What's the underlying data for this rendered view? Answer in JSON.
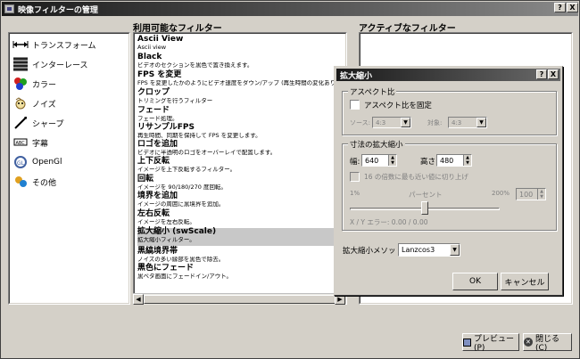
{
  "window": {
    "title": "映像フィルターの管理",
    "help_btn": "?",
    "close_btn": "X"
  },
  "headers": {
    "available": "利用可能なフィルター",
    "active": "アクティブなフィルター"
  },
  "categories": [
    {
      "label": "トランスフォーム",
      "icon": "transform-icon"
    },
    {
      "label": "インターレース",
      "icon": "interlace-icon"
    },
    {
      "label": "カラー",
      "icon": "color-icon"
    },
    {
      "label": "ノイズ",
      "icon": "noise-icon"
    },
    {
      "label": "シャープ",
      "icon": "sharpen-icon"
    },
    {
      "label": "字幕",
      "icon": "subtitle-icon"
    },
    {
      "label": "OpenGl",
      "icon": "opengl-icon"
    },
    {
      "label": "その他",
      "icon": "misc-icon"
    }
  ],
  "filters": [
    {
      "name": "Ascii View",
      "desc": "Ascii view"
    },
    {
      "name": "Black",
      "desc": "ビデオのセクションを黒色で置き換えます。"
    },
    {
      "name": "FPS を変更",
      "desc": "FPS を変更したかのようにビデオ速度をダウン/アップ (再生時間の変化あり)。"
    },
    {
      "name": "クロップ",
      "desc": "トリミングを行うフィルター"
    },
    {
      "name": "フェード",
      "desc": "フェード処理。"
    },
    {
      "name": "リサンプルFPS",
      "desc": "再生時間、同期を保持して FPS を変更します。"
    },
    {
      "name": "ロゴを追加",
      "desc": "ビデオに半透明のロゴをオーバーレイで配置します。"
    },
    {
      "name": "上下反転",
      "desc": "イメージを上下反転するフィルター。"
    },
    {
      "name": "回転",
      "desc": "イメージを 90/180/270 度回転。"
    },
    {
      "name": "境界を追加",
      "desc": "イメージの周囲に黒境界を追加。"
    },
    {
      "name": "左右反転",
      "desc": "イメージを左右反転。"
    },
    {
      "name": "拡大縮小 (swScale)",
      "desc": "拡大縮小フィルター。"
    },
    {
      "name": "黒縞境界帯",
      "desc": "ノイズの多い縁部を黒色で除去。"
    },
    {
      "name": "黒色にフェード",
      "desc": "黒ベタ画面にフェードイン/アウト。"
    }
  ],
  "buttons": {
    "preview": "プレビュー(P)",
    "close": "閉じる(C)"
  },
  "dialog": {
    "title": "拡大縮小",
    "help_btn": "?",
    "close_btn": "X",
    "aspect_group": "アスペクト比",
    "lock_aspect": "アスペクト比を固定",
    "source_label": "ソース:",
    "source_value": "4:3",
    "target_label": "対象:",
    "target_value": "4:3",
    "size_group": "寸法の拡大縮小",
    "width_label": "幅:",
    "width_value": "640",
    "height_label": "高さ:",
    "height_value": "480",
    "round16": "16 の倍数に最も近い値に切り上げ",
    "pct_min": "1%",
    "pct_label": "パーセント",
    "pct_max": "200%",
    "pct_value": "100",
    "pct_fraction": 0.5,
    "xy_error": "X / Y エラー: 0.00 / 0.00",
    "method_label": "拡大縮小メソッド:",
    "method_value": "Lanzcos3",
    "ok": "OK",
    "cancel": "キャンセル"
  }
}
